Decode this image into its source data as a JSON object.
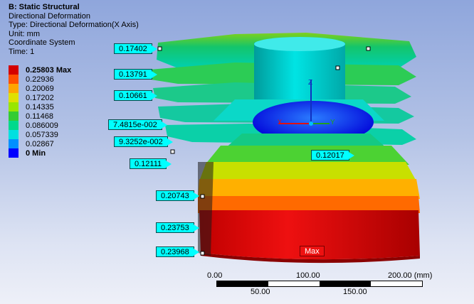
{
  "info": {
    "title": "B: Static Structural",
    "line1": "Directional Deformation",
    "line2": "Type: Directional Deformation(X Axis)",
    "line3": "Unit: mm",
    "line4": "Coordinate System",
    "line5": "Time: 1"
  },
  "legend": [
    {
      "label": "0.25803 Max",
      "color": "#d40000"
    },
    {
      "label": "0.22936",
      "color": "#ff5000"
    },
    {
      "label": "0.20069",
      "color": "#ffa500"
    },
    {
      "label": "0.17202",
      "color": "#e0e000"
    },
    {
      "label": "0.14335",
      "color": "#99e600"
    },
    {
      "label": "0.11468",
      "color": "#33cc33"
    },
    {
      "label": "0.086009",
      "color": "#00d98c"
    },
    {
      "label": "0.057339",
      "color": "#00e0e0"
    },
    {
      "label": "0.02867",
      "color": "#0090ff"
    },
    {
      "label": "0 Min",
      "color": "#0000ff"
    }
  ],
  "probes": [
    "0.17402",
    "0.13791",
    "0.10661",
    "7.4815e-002",
    "9.3252e-002",
    "0.12111",
    "0.12017",
    "0.20743",
    "0.23753",
    "0.23968"
  ],
  "max_tag": "Max",
  "axes": {
    "y": "Y",
    "z": "Z",
    "x": "X"
  },
  "scale": {
    "t0": "0.00",
    "t1": "100.00",
    "t2": "200.00 (mm)",
    "b1": "50.00",
    "b2": "150.00"
  }
}
